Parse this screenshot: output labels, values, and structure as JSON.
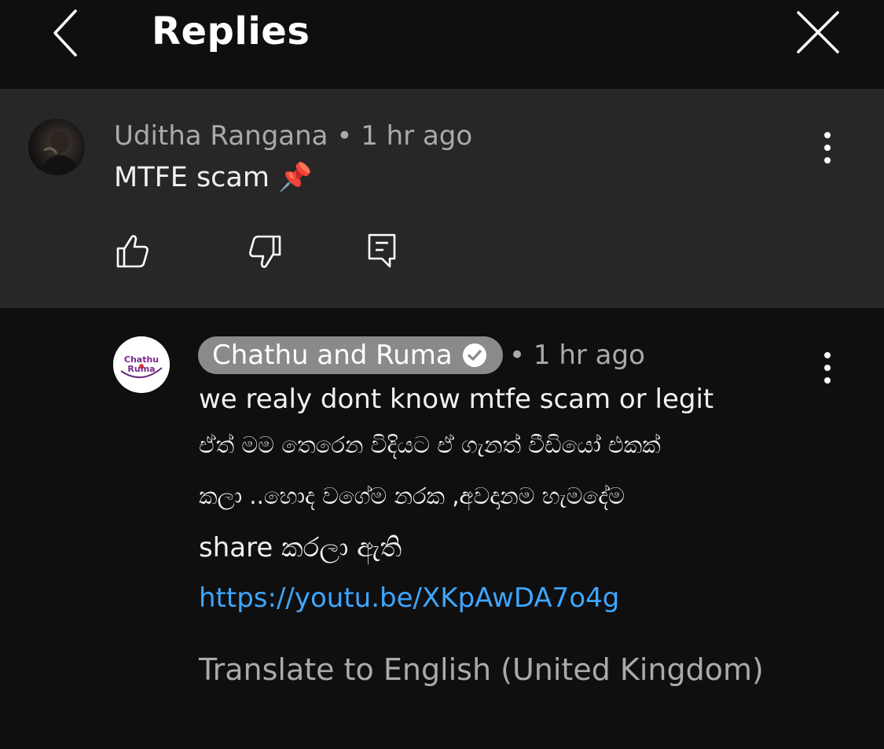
{
  "header": {
    "title": "Replies"
  },
  "parent_comment": {
    "author": "Uditha Rangana",
    "separator": "•",
    "time": "1 hr ago",
    "text": "MTFE scam 📌"
  },
  "reply": {
    "author": "Chathu and Ruma",
    "avatar_text": "Chathu Ruma",
    "separator": "•",
    "time": "1 hr ago",
    "line1": "we realy dont know mtfe scam or legit",
    "line2": "ඒත් මම තෙරෙන විදියට ඒ ගැනත් වීඩියෝ එකක්",
    "line3": "කලා ..හොද වගේම නරක ,අවදානම හැමදේම",
    "line4": "share කරලා ඇති",
    "link": "https://youtu.be/XKpAwDA7o4g",
    "translate": "Translate to English (United Kingdom)"
  },
  "icons": {
    "back": "chevron-left-icon",
    "close": "close-icon",
    "more": "more-vertical-icon",
    "like": "thumbs-up-icon",
    "dislike": "thumbs-down-icon",
    "reply": "reply-icon",
    "verified": "verified-check-icon"
  },
  "colors": {
    "background": "#0f0f0f",
    "parent_background": "#272727",
    "link": "#3ea6ff",
    "secondary_text": "#aaaaaa",
    "channel_pill": "#8a8a8a"
  }
}
